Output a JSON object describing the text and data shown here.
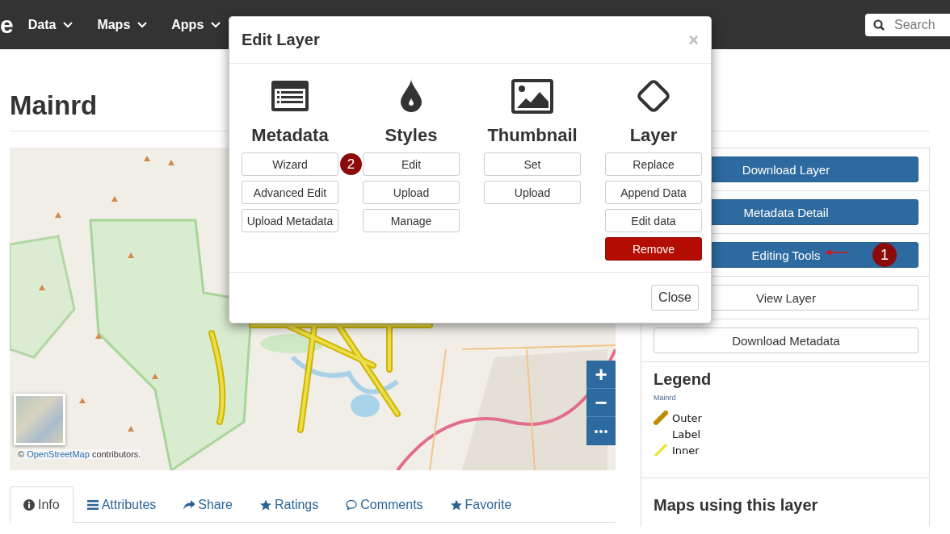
{
  "navbar": {
    "logo_fragment": "e",
    "menu": [
      {
        "label": "Data"
      },
      {
        "label": "Maps"
      },
      {
        "label": "Apps"
      }
    ],
    "search": {
      "placeholder": "Search"
    }
  },
  "page": {
    "title": "Mainrd"
  },
  "map": {
    "kind": "picture",
    "attribution": {
      "prefix": "©",
      "link": "OpenStreetMap",
      "suffix": "contributors."
    },
    "zoom_controls": [
      "+",
      "−"
    ]
  },
  "tabs": [
    {
      "label": "Info",
      "selected": true
    },
    {
      "label": "Attributes",
      "selected": false
    },
    {
      "label": "Share",
      "selected": false
    },
    {
      "label": "Ratings",
      "selected": false
    },
    {
      "label": "Comments",
      "selected": false
    },
    {
      "label": "Favorite",
      "selected": false
    }
  ],
  "sidebar": {
    "buttons": [
      {
        "label": "Download Layer",
        "kind": "primary"
      },
      {
        "label": "Metadata Detail",
        "kind": "primary"
      },
      {
        "label": "Editing Tools",
        "kind": "primary",
        "callout": "1"
      },
      {
        "label": "View Layer",
        "kind": "default"
      },
      {
        "label": "Download Metadata",
        "kind": "default"
      }
    ],
    "legend": {
      "title": "Legend",
      "layer": "Mainrd",
      "items": [
        {
          "label": "Outer",
          "kind": "thick",
          "color": "#c08a00"
        },
        {
          "label": "Label",
          "kind": "blank"
        },
        {
          "label": "Inner",
          "kind": "thin",
          "color": "#e6e63c"
        }
      ]
    },
    "maps_heading": "Maps using this layer"
  },
  "modal": {
    "title": "Edit Layer",
    "close_glyph": "×",
    "sections": [
      {
        "heading": "Metadata",
        "buttons": [
          {
            "label": "Wizard",
            "kind": "default",
            "callout": "2"
          },
          {
            "label": "Advanced Edit",
            "kind": "default"
          },
          {
            "label": "Upload Metadata",
            "kind": "default"
          }
        ]
      },
      {
        "heading": "Styles",
        "buttons": [
          {
            "label": "Edit",
            "kind": "default"
          },
          {
            "label": "Upload",
            "kind": "default"
          },
          {
            "label": "Manage",
            "kind": "default"
          }
        ]
      },
      {
        "heading": "Thumbnail",
        "buttons": [
          {
            "label": "Set",
            "kind": "default"
          },
          {
            "label": "Upload",
            "kind": "default"
          }
        ]
      },
      {
        "heading": "Layer",
        "buttons": [
          {
            "label": "Replace",
            "kind": "default"
          },
          {
            "label": "Append Data",
            "kind": "default"
          },
          {
            "label": "Edit data",
            "kind": "default"
          },
          {
            "label": "Remove",
            "kind": "danger"
          }
        ]
      }
    ],
    "footer_button": "Close"
  }
}
